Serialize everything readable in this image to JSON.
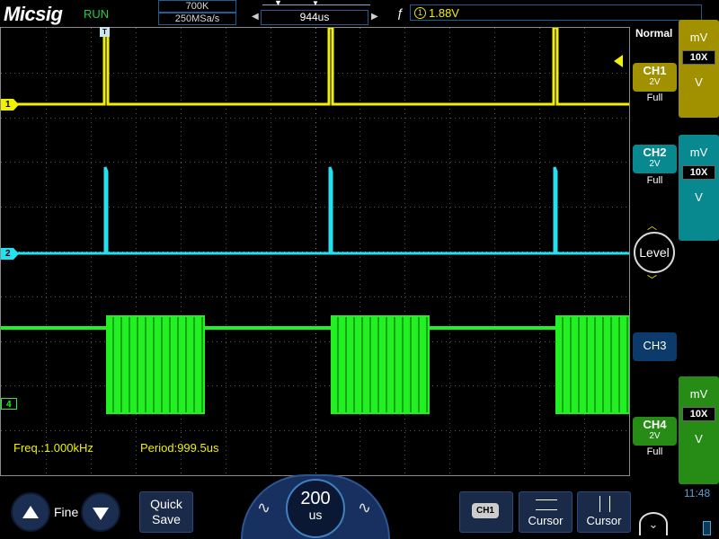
{
  "header": {
    "logo": "Micsig",
    "run_state": "RUN",
    "memory_depth": "700K",
    "sample_rate": "250MSa/s",
    "trigger_position": "944us",
    "trigger_source_icon": "1",
    "trigger_level": "1.88V",
    "trig_marker_label": "T"
  },
  "measurements": {
    "freq": "Freq.:1.000kHz",
    "period": "Period:999.5us"
  },
  "channel_markers": {
    "ch1": "1",
    "ch2": "2",
    "ch4": "4"
  },
  "side_panel": {
    "trigger_mode": "Normal",
    "level_label": "Level",
    "channels": [
      {
        "name": "CH1",
        "scale": "2V",
        "bandwidth": "Full",
        "color": "#f0f000",
        "probe_units_top": "mV",
        "probe_ratio": "10X",
        "probe_units_bottom": "V"
      },
      {
        "name": "CH2",
        "scale": "2V",
        "bandwidth": "Full",
        "color": "#25e0f0",
        "probe_units_top": "mV",
        "probe_ratio": "10X",
        "probe_units_bottom": "V"
      },
      {
        "name": "CH3"
      },
      {
        "name": "CH4",
        "scale": "2V",
        "bandwidth": "Full",
        "color": "#22f022",
        "probe_units_top": "mV",
        "probe_ratio": "10X",
        "probe_units_bottom": "V"
      }
    ],
    "clock": "11:48"
  },
  "bottom_bar": {
    "fine_label": "Fine",
    "quick_save_line1": "Quick",
    "quick_save_line2": "Save",
    "timebase_value": "200",
    "timebase_unit": "us",
    "channel_select": "CH1",
    "cursor_horizontal": "Cursor",
    "cursor_vertical": "Cursor"
  }
}
